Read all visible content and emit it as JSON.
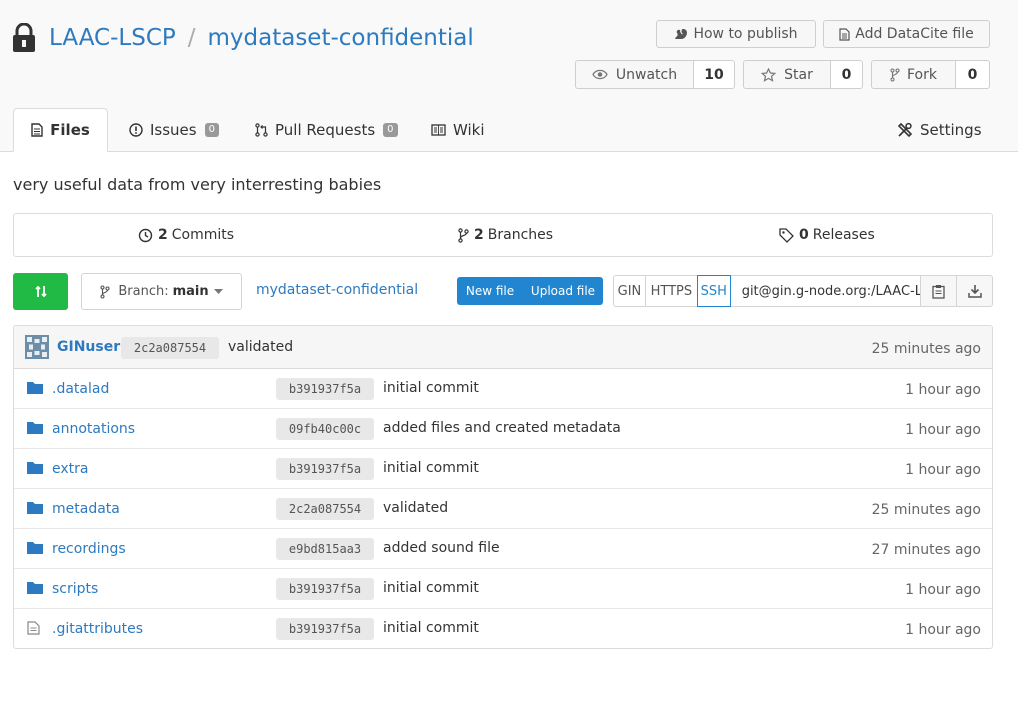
{
  "repo": {
    "owner": "LAAC-LSCP",
    "separator": "/",
    "name": "mydataset-confidential",
    "description": "very useful data from very interresting babies"
  },
  "header_buttons": {
    "how_to_publish": "How to publish",
    "add_datacite": "Add DataCite file",
    "unwatch": "Unwatch",
    "watch_count": "10",
    "star": "Star",
    "star_count": "0",
    "fork": "Fork",
    "fork_count": "0"
  },
  "tabs": {
    "files": "Files",
    "issues": "Issues",
    "issues_count": "0",
    "pull_requests": "Pull Requests",
    "pull_requests_count": "0",
    "wiki": "Wiki",
    "settings": "Settings"
  },
  "stats": {
    "commits_count": "2",
    "commits_label": "Commits",
    "branches_count": "2",
    "branches_label": "Branches",
    "releases_count": "0",
    "releases_label": "Releases"
  },
  "toolbar": {
    "branch_prefix": "Branch:",
    "branch_name": "main",
    "breadcrumb": "mydataset-confidential",
    "new_file": "New file",
    "upload_file": "Upload file",
    "clone_gin": "GIN",
    "clone_https": "HTTPS",
    "clone_ssh": "SSH",
    "clone_url": "git@gin.g-node.org:/LAAC-LSCP/mydataset-confidential.git"
  },
  "latest_commit": {
    "user": "GINuser",
    "sha": "2c2a087554",
    "message": "validated",
    "age": "25 minutes ago"
  },
  "files": [
    {
      "name": ".datalad",
      "type": "folder",
      "sha": "b391937f5a",
      "message": "initial commit",
      "age": "1 hour ago"
    },
    {
      "name": "annotations",
      "type": "folder",
      "sha": "09fb40c00c",
      "message": "added files and created metadata",
      "age": "1 hour ago"
    },
    {
      "name": "extra",
      "type": "folder",
      "sha": "b391937f5a",
      "message": "initial commit",
      "age": "1 hour ago"
    },
    {
      "name": "metadata",
      "type": "folder",
      "sha": "2c2a087554",
      "message": "validated",
      "age": "25 minutes ago"
    },
    {
      "name": "recordings",
      "type": "folder",
      "sha": "e9bd815aa3",
      "message": "added sound file",
      "age": "27 minutes ago"
    },
    {
      "name": "scripts",
      "type": "folder",
      "sha": "b391937f5a",
      "message": "initial commit",
      "age": "1 hour ago"
    },
    {
      "name": ".gitattributes",
      "type": "file",
      "sha": "b391937f5a",
      "message": "initial commit",
      "age": "1 hour ago"
    }
  ],
  "colors": {
    "link": "#2d7ac0",
    "primary": "#2185d0",
    "success": "#21ba45"
  }
}
